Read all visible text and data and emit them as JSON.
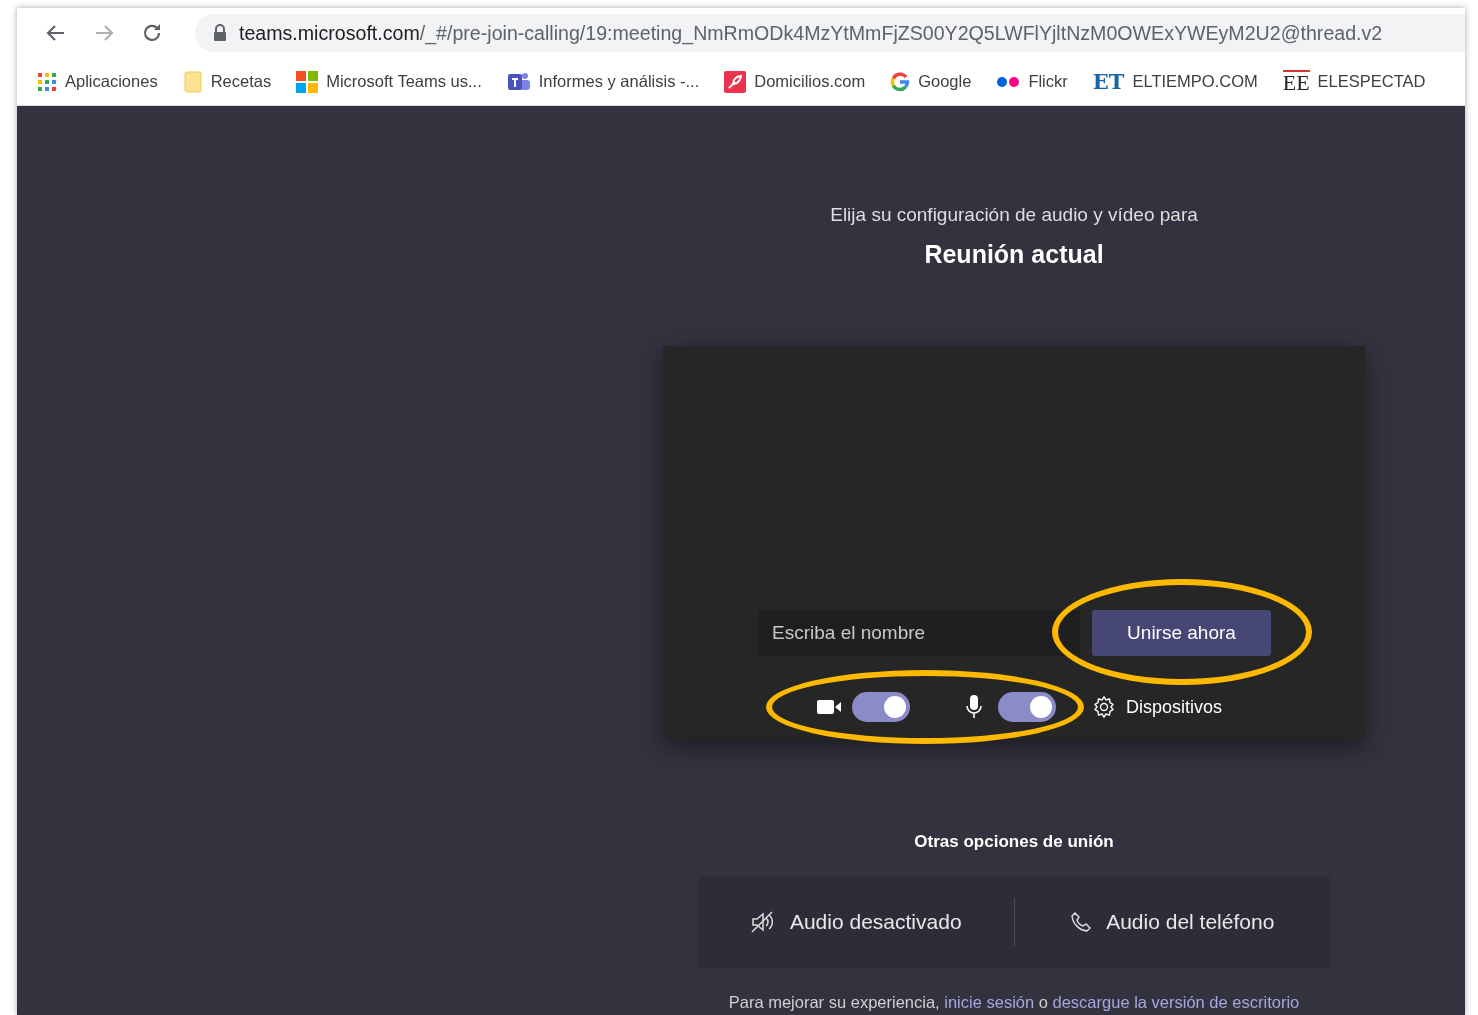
{
  "browser": {
    "nav": [
      {
        "kind": "back",
        "disabled": false
      },
      {
        "kind": "forward",
        "disabled": true
      },
      {
        "kind": "reload",
        "disabled": false
      }
    ],
    "url": {
      "host": "teams.microsoft.com",
      "path": "/_#/pre-join-calling/19:meeting_NmRmODk4MzYtMmFjZS00Y2Q5LWFlYjltNzM0OWExYWEyM2U2@thread.v2"
    },
    "bookmarks": [
      {
        "kind": "apps",
        "label": "Aplicaciones"
      },
      {
        "kind": "folder",
        "label": "Recetas"
      },
      {
        "kind": "windows",
        "label": "Microsoft Teams us..."
      },
      {
        "kind": "teams",
        "label": "Informes y análisis -..."
      },
      {
        "kind": "domicilios",
        "label": "Domicilios.com"
      },
      {
        "kind": "google",
        "label": "Google"
      },
      {
        "kind": "flickr",
        "label": "Flickr"
      },
      {
        "kind": "text",
        "icon_text": "ET",
        "label": "ELTIEMPO.COM"
      },
      {
        "kind": "serif",
        "icon_text": "EE",
        "label": "ELESPECTAD"
      }
    ]
  },
  "prejoin": {
    "subtitle": "Elija su configuración de audio y vídeo para",
    "title": "Reunión actual",
    "name_field": {
      "placeholder": "Escriba el nombre"
    },
    "join_button": {
      "label": "Unirse ahora",
      "highlighted": true
    },
    "toggles_highlighted": true,
    "toggles": [
      {
        "kind": "camera",
        "on": true
      },
      {
        "kind": "mic",
        "on": true
      }
    ],
    "devices": {
      "label": "Dispositivos"
    },
    "other_title": "Otras opciones de unión",
    "options": [
      {
        "kind": "audio-off",
        "label": "Audio desactivado"
      },
      {
        "kind": "phone",
        "label": "Audio del teléfono"
      }
    ],
    "footer": [
      {
        "kind": "text",
        "text": "Para mejorar su experiencia, "
      },
      {
        "kind": "link",
        "text": "inicie sesión"
      },
      {
        "kind": "text",
        "text": " o "
      },
      {
        "kind": "link",
        "text": "descargue la versión de escritorio"
      }
    ]
  }
}
